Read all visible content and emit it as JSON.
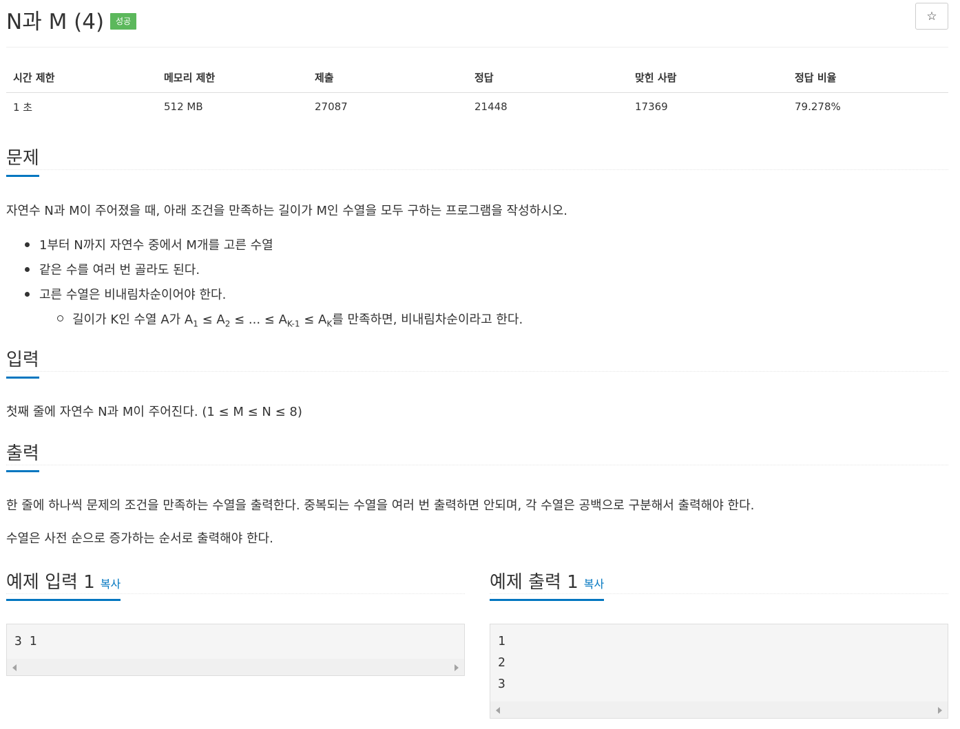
{
  "problem": {
    "title": "N과 M (4)",
    "status_badge": "성공",
    "star_icon": "☆"
  },
  "stats": {
    "headers": [
      "시간 제한",
      "메모리 제한",
      "제출",
      "정답",
      "맞힌 사람",
      "정답 비율"
    ],
    "values": [
      "1 초",
      "512 MB",
      "27087",
      "21448",
      "17369",
      "79.278%"
    ]
  },
  "sections": {
    "description": {
      "title": "문제",
      "intro": "자연수 N과 M이 주어졌을 때, 아래 조건을 만족하는 길이가 M인 수열을 모두 구하는 프로그램을 작성하시오.",
      "bullets": [
        "1부터 N까지 자연수 중에서 M개를 고른 수열",
        "같은 수를 여러 번 골라도 된다.",
        "고른 수열은 비내림차순이어야 한다."
      ],
      "sub_bullet": {
        "prefix": "길이가 K인 수열 A가 A",
        "s1": "1",
        "t1": " ≤ A",
        "s2": "2",
        "t2": " ≤ ... ≤ A",
        "s3": "K-1",
        "t3": " ≤ A",
        "s4": "K",
        "suffix": "를 만족하면, 비내림차순이라고 한다."
      }
    },
    "input": {
      "title": "입력",
      "text": "첫째 줄에 자연수 N과 M이 주어진다. (1 ≤ M ≤ N ≤ 8)"
    },
    "output": {
      "title": "출력",
      "text1": "한 줄에 하나씩 문제의 조건을 만족하는 수열을 출력한다. 중복되는 수열을 여러 번 출력하면 안되며, 각 수열은 공백으로 구분해서 출력해야 한다.",
      "text2": "수열은 사전 순으로 증가하는 순서로 출력해야 한다."
    }
  },
  "samples": {
    "input": {
      "title": "예제 입력 1",
      "copy": "복사",
      "content": "3 1"
    },
    "output": {
      "title": "예제 출력 1",
      "copy": "복사",
      "content": "1\n2\n3"
    }
  },
  "colors": {
    "accent": "#0076c0",
    "success": "#5cb85c"
  }
}
